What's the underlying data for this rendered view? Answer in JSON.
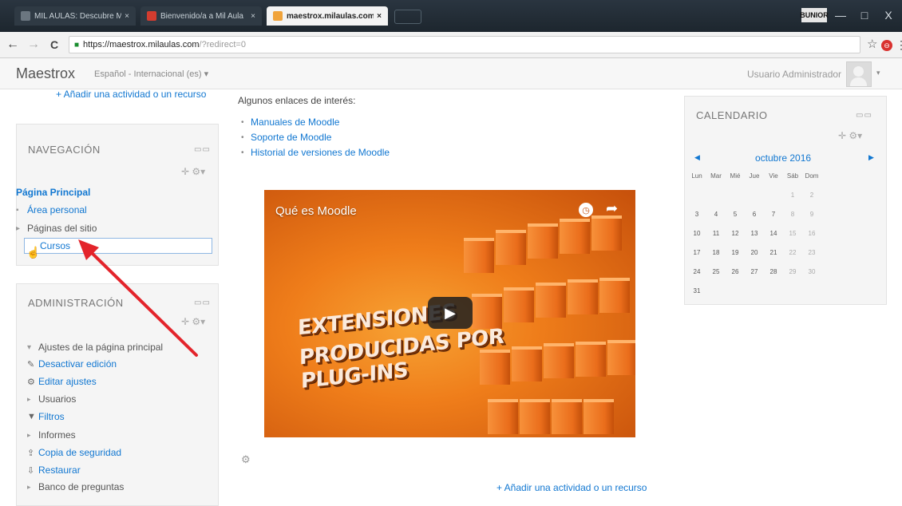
{
  "browser": {
    "tabs": [
      {
        "label": "MIL AULAS: Descubre Mi",
        "favicon_color": "#6b7680"
      },
      {
        "label": "Bienvenido/a a Mil Aula",
        "favicon_color": "#d33c2f"
      },
      {
        "label": "maestrox.milaulas.com",
        "favicon_color": "#f0a33a"
      }
    ],
    "tab_close": "×",
    "window_user": "BUNIOR",
    "window_buttons": [
      "—",
      "□",
      "X"
    ],
    "url_host": "https://maestrox.milaulas.com",
    "url_path": "/?redirect=0",
    "lock_icon": "🔒",
    "back": "←",
    "forward": "→",
    "reload": "C",
    "star": "☆",
    "ext_icon": "⊖",
    "menu": "⋮"
  },
  "navbar": {
    "brand": "Maestrox",
    "language": "Español - Internacional (es) ▾",
    "user": "Usuario Administrador",
    "caret": "▾"
  },
  "left": {
    "add_activity_top": "+ Añadir una actividad o un recurso",
    "navigation": {
      "title": "NAVEGACIÓN",
      "dock": "▭▭",
      "tools": "✛ ⚙▾",
      "home": "Página Principal",
      "items": [
        {
          "marker": "▪",
          "label": "Área personal"
        },
        {
          "marker": "▸",
          "label": "Páginas del sitio"
        },
        {
          "marker": "",
          "label": "Cursos"
        }
      ]
    },
    "administration": {
      "title": "ADMINISTRACIÓN",
      "dock": "▭▭",
      "tools": "✛ ⚙▾",
      "section": "Ajustes de la página principal",
      "section_marker": "▾",
      "items": [
        {
          "icon": "✎",
          "label": "Desactivar edición"
        },
        {
          "icon": "⚙",
          "label": "Editar ajustes"
        },
        {
          "icon": "▸",
          "label": "Usuarios"
        },
        {
          "icon": "▼",
          "label": "Filtros"
        },
        {
          "icon": "▸",
          "label": "Informes"
        },
        {
          "icon": "⇪",
          "label": "Copia de seguridad"
        },
        {
          "icon": "⇩",
          "label": "Restaurar"
        },
        {
          "icon": "▸",
          "label": "Banco de preguntas"
        }
      ]
    }
  },
  "main": {
    "heading": "Algunos enlaces de interés:",
    "links": [
      "Manuales de Moodle",
      "Soporte de Moodle",
      "Historial de versiones de Moodle"
    ],
    "video": {
      "title": "Qué es Moodle",
      "overlay_lines": [
        "EXTENSIONES",
        "PRODUCIDAS POR",
        "PLUG-INS"
      ],
      "play": "▶",
      "clock": "◷",
      "share": "➦"
    },
    "gear": "⚙",
    "add_activity": "+ Añadir una actividad o un recurso"
  },
  "calendar": {
    "title": "CALENDARIO",
    "dock": "▭▭",
    "tools": "✛ ⚙▾",
    "prev": "◀",
    "next": "▶",
    "month": "octubre 2016",
    "days": [
      "Lun",
      "Mar",
      "Mié",
      "Jue",
      "Vie",
      "Sáb",
      "Dom"
    ],
    "weeks": [
      [
        "",
        "",
        "",
        "",
        "",
        "1",
        "2"
      ],
      [
        "3",
        "4",
        "5",
        "6",
        "7",
        "8",
        "9"
      ],
      [
        "10",
        "11",
        "12",
        "13",
        "14",
        "15",
        "16"
      ],
      [
        "17",
        "18",
        "19",
        "20",
        "21",
        "22",
        "23"
      ],
      [
        "24",
        "25",
        "26",
        "27",
        "28",
        "29",
        "30"
      ],
      [
        "31",
        "",
        "",
        "",
        "",
        "",
        ""
      ]
    ]
  },
  "colors": {
    "link": "#1177d1",
    "arrow": "#e3242b",
    "video_orange": "#ef7d1a"
  }
}
